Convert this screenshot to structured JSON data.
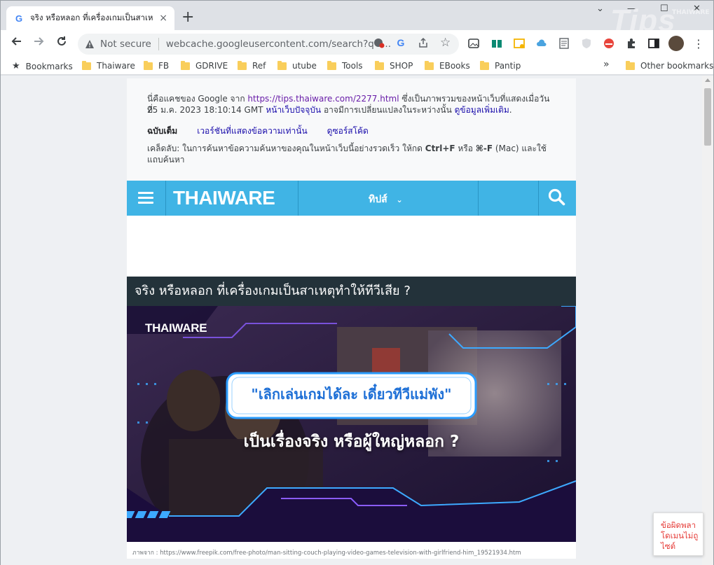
{
  "tab": {
    "title": "จริง หรือหลอก ที่เครื่องเกมเป็นสาเหตุทำ",
    "close": "×"
  },
  "new_tab": "+",
  "window_controls": {
    "minimize": "—",
    "maximize": "☐",
    "close": "✕",
    "tab_search": "⌄"
  },
  "omnibox": {
    "security": "Not secure",
    "url": "webcache.googleusercontent.com/search?q=..."
  },
  "bookmarks": {
    "star_label": "Bookmarks",
    "items": [
      "Thaiware",
      "FB",
      "GDRIVE",
      "Ref",
      "utube",
      "Tools",
      "SHOP",
      "EBooks",
      "Pantip"
    ],
    "overflow": "»",
    "other": "Other bookmarks"
  },
  "cache": {
    "line1_a": "นี่คือแคชของ Google จาก ",
    "line1_link": "https://tips.thaiware.com/2277.html",
    "line1_b": " ซึ่งเป็นภาพรวมของหน้าเว็บที่แสดงเมื่อวันที่",
    "line2_a": "25 ม.ค. 2023 18:10:14 GMT ",
    "line2_link1": "หน้าเว็บปัจจุบัน",
    "line2_b": " อาจมีการเปลี่ยนแปลงในระหว่างนั้น ",
    "line2_link2": "ดูข้อมูลเพิ่มเติม",
    "line2_c": ".",
    "tabs": [
      "ฉบับเต็ม",
      "เวอร์ชันที่แสดงข้อความเท่านั้น",
      "ดูซอร์สโค้ด"
    ],
    "tip_a": "เคล็ดลับ: ในการค้นหาข้อความค้นหาของคุณในหน้าเว็บนี้อย่างรวดเร็ว ให้กด ",
    "tip_keys": "Ctrl+F",
    "tip_b": " หรือ ",
    "tip_mac": "⌘-F",
    "tip_c": " (Mac) และใช้",
    "tip_line2": "แถบค้นหา"
  },
  "site": {
    "logo": "THAIWARE",
    "menu": "ทิปส์",
    "headline": "จริง หรือหลอก ที่เครื่องเกมเป็นสาเหตุทำให้ทีวีเสีย ?",
    "banner_logo": "THAIWARE",
    "banner_quote": "\"เลิกเล่นเกมได้ละ เดี๋ยวทีวีแม่พัง\"",
    "banner_question": "เป็นเรื่องจริง หรือผู้ใหญ่หลอก ?",
    "caption": "ภาพจาก : https://www.freepik.com/free-photo/man-sitting-couch-playing-video-games-television-with-girlfriend-him_19521934.htm"
  },
  "popup": {
    "line1": "ข้อผิดพลา",
    "line2": "โดเมนไม่ถู",
    "line3": "ไซต์"
  },
  "watermark": {
    "big": "Tips",
    "small": "THAIWARE"
  },
  "colors": {
    "thaiware_blue": "#40b4e5",
    "headline_bg": "#23323a",
    "banner_bg": "#150b33"
  }
}
